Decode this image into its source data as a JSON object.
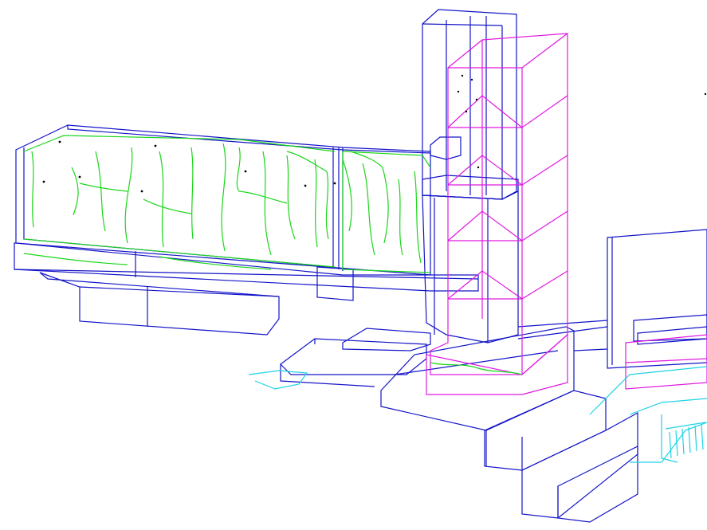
{
  "colors": {
    "background": "#ffffff",
    "structure": "#1414c8",
    "cracks": "#19d619",
    "tower_frame": "#e019e0",
    "ground_cyan": "#1ed2e6",
    "points": "#000000"
  },
  "layers": [
    {
      "name": "structure",
      "color_key": "structure"
    },
    {
      "name": "cracks",
      "color_key": "cracks"
    },
    {
      "name": "tower_frame",
      "color_key": "tower_frame"
    },
    {
      "name": "ground_cyan",
      "color_key": "ground_cyan"
    }
  ]
}
